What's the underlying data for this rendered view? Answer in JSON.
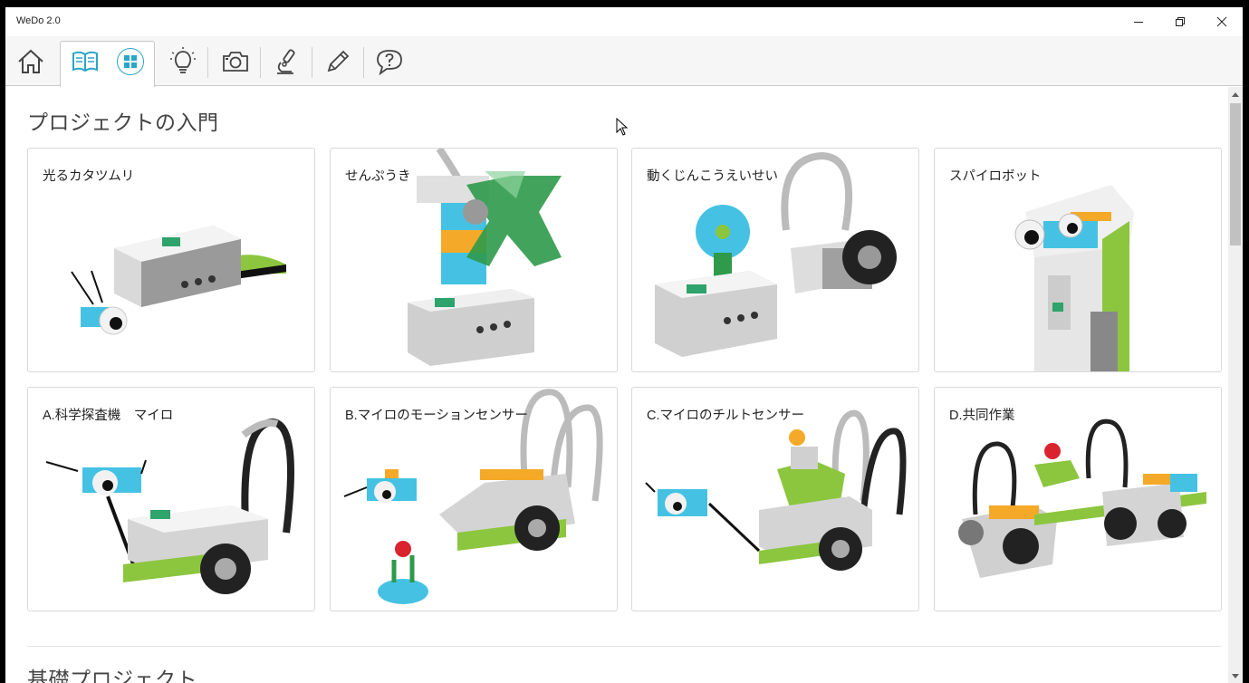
{
  "window": {
    "title": "WeDo 2.0"
  },
  "toolbar": {
    "items": [
      {
        "icon": "home-icon"
      },
      {
        "icon": "book-icon"
      },
      {
        "icon": "grid-icon"
      },
      {
        "icon": "lightbulb-icon"
      },
      {
        "icon": "camera-icon"
      },
      {
        "icon": "microscope-icon"
      },
      {
        "icon": "pencil-icon"
      },
      {
        "icon": "help-icon"
      }
    ],
    "accent": "#2aa6c8"
  },
  "sections": [
    {
      "title": "プロジェクトの入門",
      "cards": [
        {
          "label": "光るカタツムリ"
        },
        {
          "label": "せんぷうき"
        },
        {
          "label": "動くじんこうえいせい"
        },
        {
          "label": "スパイロボット"
        },
        {
          "label": "A.科学探査機　マイロ"
        },
        {
          "label": "B.マイロのモーションセンサー"
        },
        {
          "label": "C.マイロのチルトセンサー"
        },
        {
          "label": "D.共同作業"
        }
      ]
    },
    {
      "title": "基礎プロジェクト"
    }
  ]
}
